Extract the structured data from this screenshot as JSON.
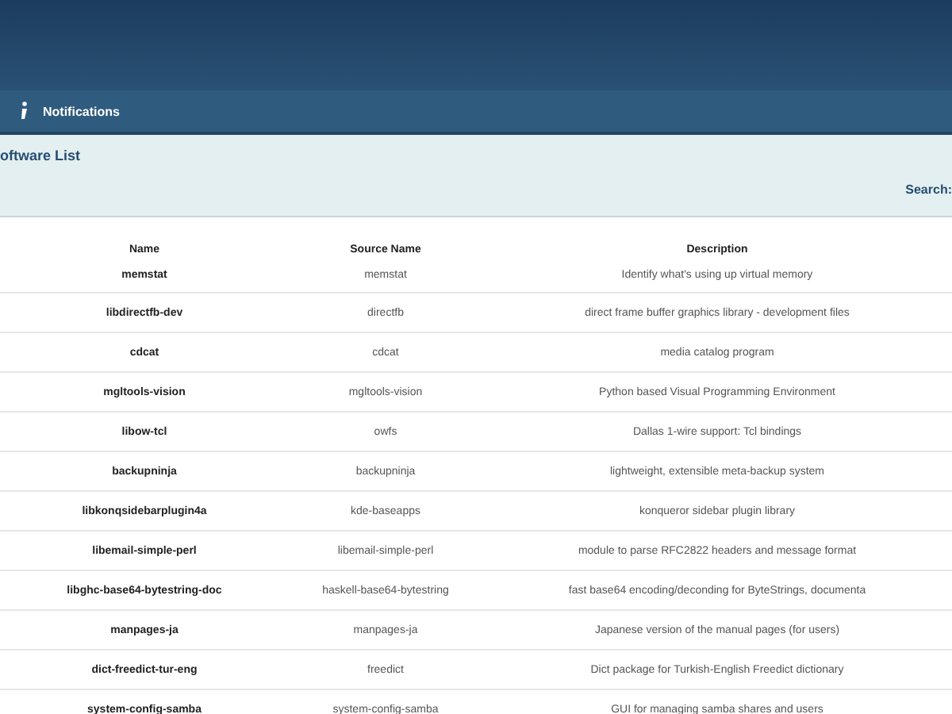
{
  "nav": {
    "label": "Notifications"
  },
  "panel": {
    "title": "oftware List",
    "search_label": "Search:"
  },
  "table": {
    "columns": [
      "Name",
      "Source Name",
      "Description"
    ],
    "rows": [
      [
        "memstat",
        "memstat",
        "Identify what's using up virtual memory"
      ],
      [
        "libdirectfb-dev",
        "directfb",
        "direct frame buffer graphics library - development files"
      ],
      [
        "cdcat",
        "cdcat",
        "media catalog program"
      ],
      [
        "mgltools-vision",
        "mgltools-vision",
        "Python based Visual Programming Environment"
      ],
      [
        "libow-tcl",
        "owfs",
        "Dallas 1-wire support: Tcl bindings"
      ],
      [
        "backupninja",
        "backupninja",
        "lightweight, extensible meta-backup system"
      ],
      [
        "libkonqsidebarplugin4a",
        "kde-baseapps",
        "konqueror sidebar plugin library"
      ],
      [
        "libemail-simple-perl",
        "libemail-simple-perl",
        "module to parse RFC2822 headers and message format"
      ],
      [
        "libghc-base64-bytestring-doc",
        "haskell-base64-bytestring",
        "fast base64 encoding/deconding for ByteStrings, documenta"
      ],
      [
        "manpages-ja",
        "manpages-ja",
        "Japanese version of the manual pages (for users)"
      ],
      [
        "dict-freedict-tur-eng",
        "freedict",
        "Dict package for Turkish-English Freedict dictionary"
      ],
      [
        "system-config-samba",
        "system-config-samba",
        "GUI for managing samba shares and users"
      ]
    ]
  }
}
